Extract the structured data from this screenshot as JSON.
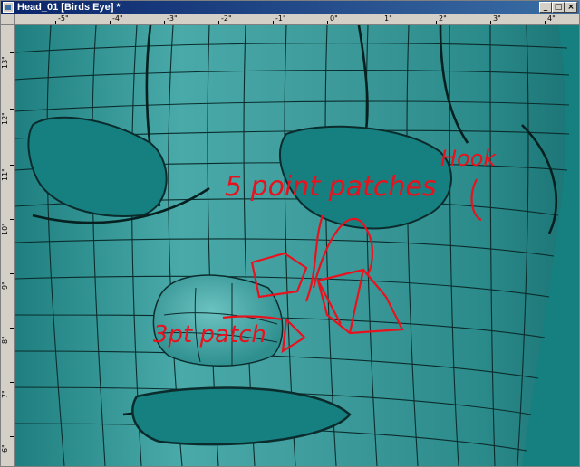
{
  "window": {
    "title": "Head_01 [Birds Eye] *"
  },
  "titlebar_buttons": {
    "minimize": "_",
    "maximize": "□",
    "close": "×"
  },
  "ruler": {
    "top_labels": [
      "-5\"",
      "-4\"",
      "-3\"",
      "-2\"",
      "-1\"",
      "0\"",
      "1\"",
      "2\"",
      "3\"",
      "4\""
    ],
    "left_labels": [
      "13\"",
      "12\"",
      "11\"",
      "10\"",
      "9\"",
      "8\"",
      "7\"",
      "6\""
    ]
  },
  "annotations": {
    "five_point": "5 point patches",
    "hook": "Hook",
    "three_point": "3pt patch"
  },
  "colors": {
    "background": "#167f80",
    "mesh": "#3fa3a3",
    "annotation": "#e8121e"
  }
}
